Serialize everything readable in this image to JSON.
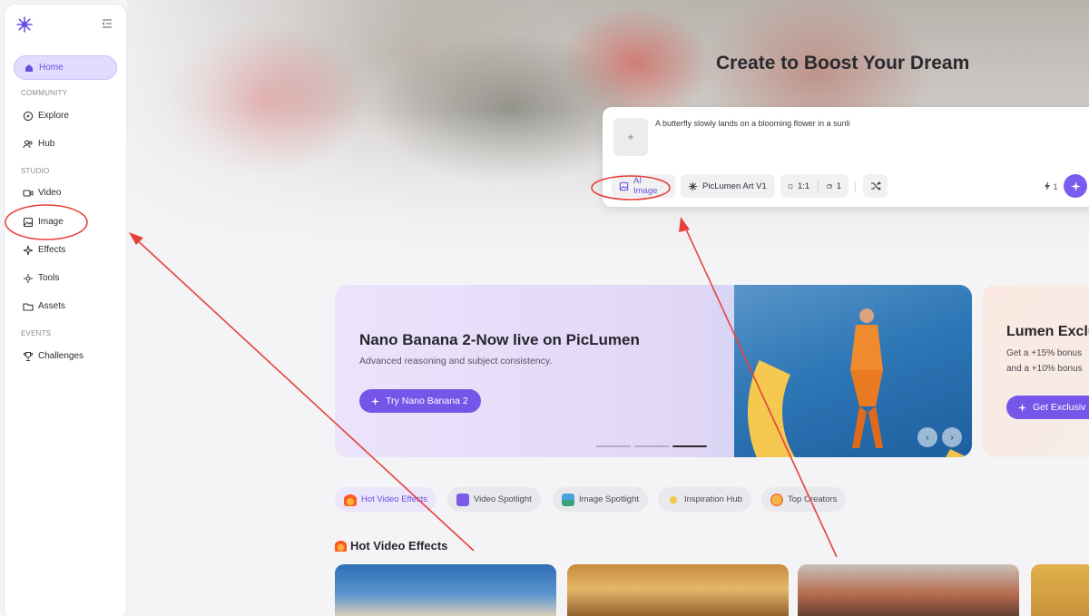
{
  "sidebar": {
    "sections": {
      "community": "COMMUNITY",
      "studio": "STUDIO",
      "events": "EVENTS"
    },
    "items": [
      {
        "label": "Home",
        "icon": "home-icon"
      },
      {
        "label": "Explore",
        "icon": "compass-icon"
      },
      {
        "label": "Hub",
        "icon": "users-icon"
      },
      {
        "label": "Video",
        "icon": "video-icon"
      },
      {
        "label": "Image",
        "icon": "image-icon"
      },
      {
        "label": "Effects",
        "icon": "sparkle-icon"
      },
      {
        "label": "Tools",
        "icon": "tools-icon"
      },
      {
        "label": "Assets",
        "icon": "folder-icon"
      },
      {
        "label": "Challenges",
        "icon": "trophy-icon"
      }
    ]
  },
  "hero": {
    "title": "Create to Boost Your Dream",
    "prompt_text": "A butterfly slowly lands on a blooming flower in a sunli",
    "upload_glyph": "+",
    "mode_label": "AI Image",
    "model_label": "PicLumen Art V1",
    "ratio_label": "1:1",
    "count_label": "1",
    "credit_label": "1"
  },
  "banner": {
    "title": "Nano Banana 2-Now live on PicLumen",
    "subtitle": "Advanced reasoning and subject consistency.",
    "cta": "Try Nano Banana 2"
  },
  "banner2": {
    "title": "Lumen Exclu",
    "line1": "Get a +15% bonus",
    "line2": "and a +10% bonus",
    "cta": "Get Exclusiv"
  },
  "tabs": [
    {
      "label": "Hot Video Effects",
      "color": "#ff6a2b"
    },
    {
      "label": "Video Spotlight",
      "color": "#7a5ae8"
    },
    {
      "label": "Image Spotlight",
      "color": "#3aa27a"
    },
    {
      "label": "Inspiration Hub",
      "color": "#f2c84b"
    },
    {
      "label": "Top Creators",
      "color": "#f08a3a"
    }
  ],
  "section": {
    "title": "Hot Video Effects"
  },
  "colors": {
    "accent": "#7656e8",
    "annotation": "#e8413a"
  }
}
